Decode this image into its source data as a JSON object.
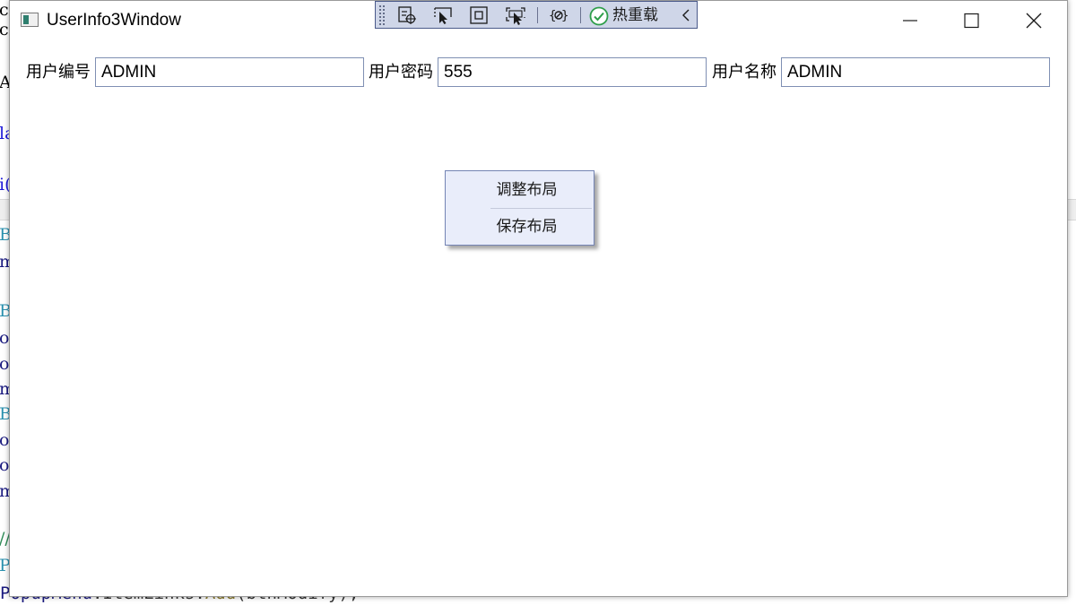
{
  "window": {
    "title": "UserInfo3Window",
    "controls": {
      "minimize": "minimize",
      "maximize": "maximize",
      "close": "close"
    }
  },
  "debug_toolbar": {
    "hot_reload_label": "热重载",
    "icons": [
      "select-element-icon",
      "pointer-icon",
      "layout-adorner-icon",
      "track-focus-icon",
      "binding-icon",
      "check-circle-icon",
      "collapse-chevron-icon"
    ]
  },
  "form": {
    "fields": [
      {
        "label": "用户编号",
        "value": "ADMIN"
      },
      {
        "label": "用户密码",
        "value": "555"
      },
      {
        "label": "用户名称",
        "value": "ADMIN"
      }
    ]
  },
  "context_menu": {
    "items": [
      {
        "label": "调整布局"
      },
      {
        "label": "保存布局"
      }
    ]
  },
  "background_editor": {
    "fragments": [
      "c",
      "c",
      "Ap",
      "la",
      "i(",
      "Ba",
      "ma",
      "Ba",
      "ot",
      "ot",
      "ma",
      "Ba",
      "ot",
      "ot",
      "ma",
      "//",
      "Pc"
    ],
    "bottom_line": {
      "object": "PopupMenu",
      "member": "ItemLinks",
      "method": "Add",
      "argument": "btnModify",
      "suffix": ");"
    }
  },
  "colors": {
    "menu_background": "#e9edfa",
    "menu_border": "#7484b4",
    "toolbar_background": "#cfd6e8",
    "input_border": "#7f8fb3"
  }
}
